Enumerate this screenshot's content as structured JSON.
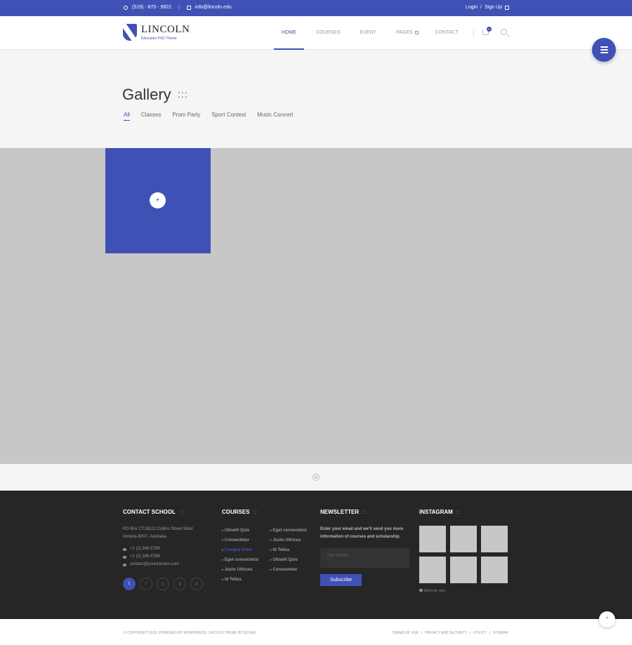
{
  "topbar": {
    "phone": "(519) - 875 - 9822",
    "email": "info@lincoln.edu",
    "login": "Login",
    "signup": "Sign Up"
  },
  "header": {
    "logo_name": "LINCOLN",
    "logo_tagline": "Education PSD Theme",
    "nav": [
      "HOME",
      "COURSES",
      "EVENT",
      "PAGES",
      "CONTACT"
    ],
    "cart_count": "0"
  },
  "title_area": {
    "title": "Gallery",
    "dots": ":::",
    "filters": [
      "All",
      "Classes",
      "Prom Party",
      "Sport Contest",
      "Music Concert"
    ]
  },
  "gallery": {
    "tile_icon": "+"
  },
  "footer": {
    "contact": {
      "heading": "CONTACT SCHOOL",
      "address_1": "PO Box CT16122 Collins Street West,",
      "address_2": "Victoria 8007, Australia.",
      "phone": "+1 (2) 345 6789",
      "fax": "+1 (2) 345 6789",
      "email": "contact@yourdomain.com"
    },
    "courses": {
      "heading": "COURSES",
      "col1": [
        "Utinelit Quis",
        "Consectetur",
        "Congue Enim",
        "Eget consectetur",
        "Justo Ultrices",
        "Id Tellus"
      ],
      "col2": [
        "Eget consectetur",
        "Justo Ultrices",
        "Id Tellus",
        "Utinelit Quis",
        "Consectetur"
      ]
    },
    "newsletter": {
      "heading": "NEWSLETTER",
      "text": "Enter your email and we'll send you more information of courses and scholarship.",
      "placeholder": "Your Email...",
      "button": "Subscribe"
    },
    "instagram": {
      "heading": "INSTAGRAM",
      "handle": "@lincoln_edu"
    },
    "heading_dots": ":::"
  },
  "bottombar": {
    "copyright": "© COPYRIGHT 2015. POWERED BY WORDPRESS. LINCOLN THEME BY DZOAN",
    "links": [
      "TERMS OF USE",
      "PRIVACY AND SECURITY",
      "POLICY",
      "SITEMAP"
    ]
  },
  "colors": {
    "accent": "#3f51b5",
    "footer_bg": "#262626",
    "placeholder_gray": "#c7c7c7"
  }
}
